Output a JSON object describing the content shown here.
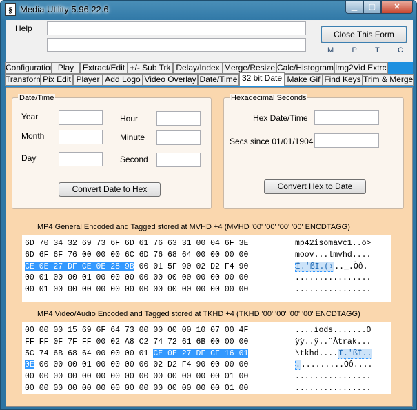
{
  "window": {
    "title": "Media Utility 5.96.22.6",
    "icon_glyph": "§",
    "min_glyph": "▁",
    "max_glyph": "▢",
    "close_glyph": "✕"
  },
  "menu": {
    "help": "Help"
  },
  "top": {
    "close_form": "Close This Form",
    "flags": [
      "M",
      "P",
      "T",
      "C"
    ]
  },
  "tabs_row1": [
    "Configuration",
    "Play",
    "Extract/Edit",
    "+/- Sub Trk",
    "Delay/Index",
    "Merge/Resize",
    "Calc/Histogram",
    "Img2Vid Extrct"
  ],
  "tabs_row2": [
    "Transform",
    "Pix Edit",
    "Player",
    "Add Logo",
    "Video Overlay",
    "Date/Time",
    "32 bit Date",
    "Make Gif",
    "Find Keys",
    "Trim & Merge"
  ],
  "selected_tab": "32 bit Date",
  "datetime": {
    "title": "Date/Time",
    "year": "Year",
    "month": "Month",
    "day": "Day",
    "hour": "Hour",
    "minute": "Minute",
    "second": "Second",
    "button": "Convert Date to Hex"
  },
  "hexsec": {
    "title": "Hexadecimal Seconds",
    "hex_date": "Hex Date/Time",
    "secs_since": "Secs since 01/01/1904",
    "button": "Convert Hex to Date"
  },
  "mvhd": {
    "label": "MP4 General Encoded and Tagged stored at MVHD +4 (MVHD '00' '00' '00' '00' ENCDTAGG)",
    "rows": [
      {
        "hex": "6D 70 34 32 69 73 6F 6D 61 76 63 31 00 04 6F 3E",
        "hl": "",
        "rest": "",
        "ascii": "mp42isomavc1..o>",
        "ahl": "",
        "arest": ""
      },
      {
        "hex": "6D 6F 6F 76 00 00 00 6C 6D 76 68 64 00 00 00 00",
        "hl": "",
        "rest": "",
        "ascii": "moov...lmvhd....",
        "ahl": "",
        "arest": ""
      },
      {
        "hex": "",
        "hl": "CE 0E 27 DF CE 0E 28 9B",
        "rest": " 00 01 5F 90 02 D2 F4 90",
        "ascii": "",
        "ahl": "Î.'ßÎ.(›",
        "arest": ".._.Òô."
      },
      {
        "hex": "00 01 00 00 01 00 00 00 00 00 00 00 00 00 00 00",
        "hl": "",
        "rest": "",
        "ascii": "................",
        "ahl": "",
        "arest": ""
      },
      {
        "hex": "00 01 00 00 00 00 00 00 00 00 00 00 00 00 00 00",
        "hl": "",
        "rest": "",
        "ascii": "................",
        "ahl": "",
        "arest": ""
      }
    ]
  },
  "tkhd": {
    "label": "MP4 Video/Audio Encoded and Tagged stored at TKHD +4 (TKHD '00' '00' '00' '00' ENCDTAGG)",
    "rows": [
      {
        "hex": "00 00 00 15 69 6F 64 73 00 00 00 00 10 07 00 4F",
        "hl": "",
        "rest": "",
        "ascii": "....iods.......O",
        "ahl": "",
        "arest": ""
      },
      {
        "hex": "FF FF 0F 7F FF 00 02 A8 C2 74 72 61 6B 00 00 00",
        "hl": "",
        "rest": "",
        "ascii": "ÿÿ..ÿ..¨Âtrak...",
        "ahl": "",
        "arest": ""
      },
      {
        "hex": "5C 74 6B 68 64 00 00 00 01 ",
        "hl": "CE 0E 27 DF CF 16 01",
        "rest": "",
        "ascii": "\\tkhd....",
        "ahl": "Î.'ßÏ..",
        "arest": ""
      },
      {
        "hex": "",
        "hl": "0E",
        "rest": " 00 00 00 01 00 00 00 00 02 D2 F4 90 00 00 00",
        "ascii": "",
        "ahl": ".",
        "arest": ".........Òô...."
      },
      {
        "hex": "00 00 00 00 00 00 00 00 00 00 00 00 00 00 01 00",
        "hl": "",
        "rest": "",
        "ascii": "................",
        "ahl": "",
        "arest": ""
      },
      {
        "hex": "00 00 00 00 00 00 00 00 00 00 00 00 00 00 01 00",
        "hl": "",
        "rest": "",
        "ascii": "................",
        "ahl": "",
        "arest": ""
      }
    ]
  }
}
